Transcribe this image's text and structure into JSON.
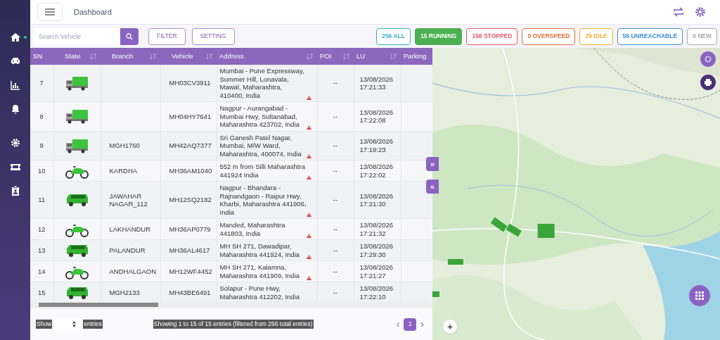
{
  "header": {
    "title": "Dashboard"
  },
  "sidebar": {
    "items": [
      {
        "selected": true
      },
      {
        "selected": false
      },
      {
        "selected": false
      },
      {
        "selected": false
      },
      {
        "selected": false
      },
      {
        "selected": false
      },
      {
        "selected": false
      }
    ]
  },
  "toolbar": {
    "search": {
      "placeholder": "Search Vehicle"
    },
    "buttons": [
      "FILTER",
      "SETTING"
    ]
  },
  "status_filters": [
    {
      "label": "256 ALL",
      "color": "#3bb0c9",
      "selected": false
    },
    {
      "label": "15 RUNNING",
      "color": "#4caf50",
      "selected": true
    },
    {
      "label": "156 STOPPED",
      "color": "#e35d6a",
      "selected": false
    },
    {
      "label": "0 OVERSPEED",
      "color": "#e0703a",
      "selected": false
    },
    {
      "label": "29 IDLE",
      "color": "#f0b429",
      "selected": false
    },
    {
      "label": "56 UNREACHABLE",
      "color": "#3d8fd6",
      "selected": false
    },
    {
      "label": "0 NEW",
      "color": "#aaaaaa",
      "selected": false
    }
  ],
  "table": {
    "columns": [
      "SN",
      "State",
      "Branch",
      "Vehicle",
      "Address",
      "POI",
      "LU",
      "Parking"
    ],
    "rows": [
      {
        "sn": "7",
        "kind": "truck",
        "branch": "",
        "vehicle": "MH03CV3911",
        "address": "Mumbai - Pune Expressway, Summer Hill, Lonavala, Mawal, Maharashtra, 410400, India",
        "alert": true,
        "poi": "--",
        "lu": "13/08/2026 17:21:33"
      },
      {
        "sn": "8",
        "kind": "truck",
        "branch": "",
        "vehicle": "MH04HY7641",
        "address": "Nagpur - Aurangabad - Mumbai Hwy, Sultanabad, Maharashtra 423702, India",
        "alert": true,
        "poi": "--",
        "lu": "13/08/2026 17:22:08"
      },
      {
        "sn": "9",
        "kind": "truck",
        "branch": "MGH1760",
        "vehicle": "MH42AQ7377",
        "address": "Sri Ganesh Patel Nagar, Mumbai, M/W Ward, Maharashtra, 400074, India",
        "alert": true,
        "poi": "--",
        "lu": "13/08/2026 17:19:23"
      },
      {
        "sn": "10",
        "kind": "bike",
        "branch": "KARDHA",
        "vehicle": "MH36AM1040",
        "address": "552 m from Silli Maharashtra 441924 India",
        "alert": true,
        "poi": "--",
        "lu": "13/08/2026 17:22:02"
      },
      {
        "sn": "11",
        "kind": "car",
        "branch": "JAWAHAR NAGAR_112",
        "vehicle": "MH12SQ2182",
        "address": "Nagpur - Bhandara - Rajnandgaon - Raipur Hwy, Kharbi, Maharashtra 441906, India",
        "alert": true,
        "poi": "--",
        "lu": "13/08/2026 17:21:30"
      },
      {
        "sn": "12",
        "kind": "bike",
        "branch": "LAKHANDUR",
        "vehicle": "MH36AP0779",
        "address": "Manded, Maharashtra 441803, India",
        "alert": true,
        "poi": "--",
        "lu": "13/08/2026 17:21:32"
      },
      {
        "sn": "13",
        "kind": "car",
        "branch": "PALANDUR",
        "vehicle": "MH36AL4617",
        "address": "MH SH 271, Dawadipar, Maharashtra 441924, India",
        "alert": true,
        "poi": "--",
        "lu": "13/08/2026 17:29:30"
      },
      {
        "sn": "14",
        "kind": "bike",
        "branch": "ANDHALGAON",
        "vehicle": "MH12WF4452",
        "address": "MH SH 271, Kalamna, Maharashtra 441909, India",
        "alert": true,
        "poi": "--",
        "lu": "13/08/2026 17:21:27"
      },
      {
        "sn": "15",
        "kind": "car",
        "branch": "MGH2133",
        "vehicle": "MH43BE6491",
        "address": "Solapur - Pune Hwy, Maharashtra 412202, India",
        "alert": false,
        "poi": "--",
        "lu": "13/08/2026 17:22:10"
      }
    ]
  },
  "footer": {
    "show_label": "Show",
    "entries_label": "entries",
    "info": "Showing 1 to 15 of 15 entries (filtered from 256 total entries)",
    "prev": "‹",
    "pages": [
      {
        "label": "1",
        "selected": true
      }
    ],
    "next": "›"
  },
  "map": {
    "expand": "»",
    "collapse": "«",
    "zoom_in": "+"
  }
}
